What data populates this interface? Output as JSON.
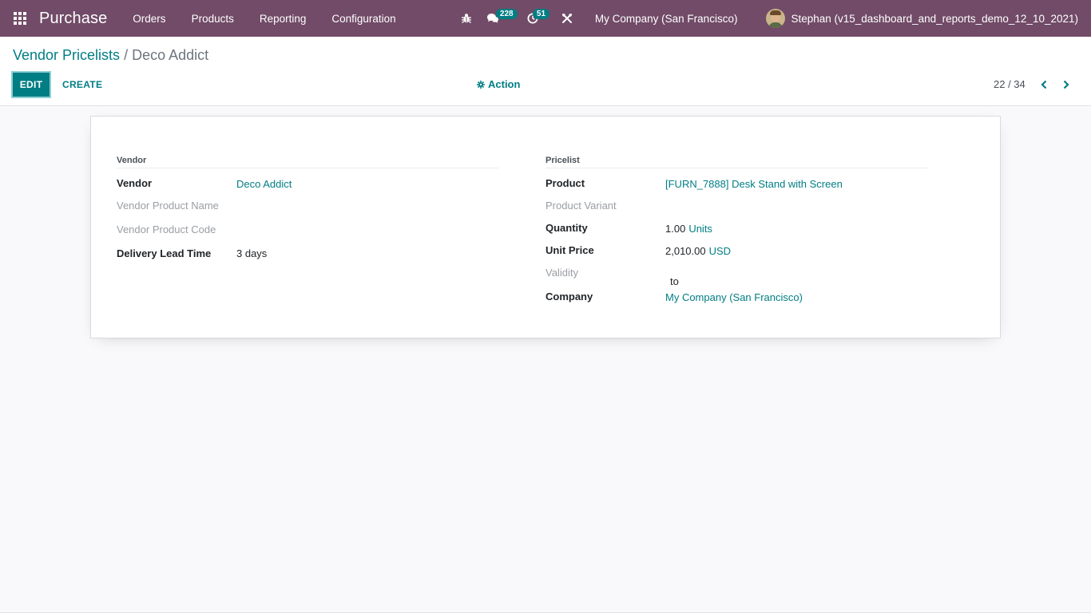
{
  "navbar": {
    "app_name": "Purchase",
    "menu": [
      "Orders",
      "Products",
      "Reporting",
      "Configuration"
    ],
    "messages_count": "228",
    "activities_count": "51",
    "company": "My Company (San Francisco)",
    "user": "Stephan (v15_dashboard_and_reports_demo_12_10_2021)",
    "bg_color": "#714b67",
    "accent_color": "#017e84"
  },
  "control_panel": {
    "breadcrumb_parent": "Vendor Pricelists",
    "breadcrumb_sep": " / ",
    "breadcrumb_current": "Deco Addict",
    "edit_label": "EDIT",
    "create_label": "CREATE",
    "action_label": "Action",
    "pager": "22 / 34"
  },
  "form": {
    "vendor_group": {
      "title": "Vendor",
      "vendor_label": "Vendor",
      "vendor_value": "Deco Addict",
      "product_name_label": "Vendor Product Name",
      "product_code_label": "Vendor Product Code",
      "lead_time_label": "Delivery Lead Time",
      "lead_time_value": "3 days"
    },
    "pricelist_group": {
      "title": "Pricelist",
      "product_label": "Product",
      "product_value": "[FURN_7888] Desk Stand with Screen",
      "variant_label": "Product Variant",
      "quantity_label": "Quantity",
      "quantity_value": "1.00",
      "quantity_unit": "Units",
      "unit_price_label": "Unit Price",
      "unit_price_value": "2,010.00",
      "unit_price_currency": "USD",
      "validity_label": "Validity",
      "validity_to": "to",
      "company_label": "Company",
      "company_value": "My Company (San Francisco)"
    }
  }
}
